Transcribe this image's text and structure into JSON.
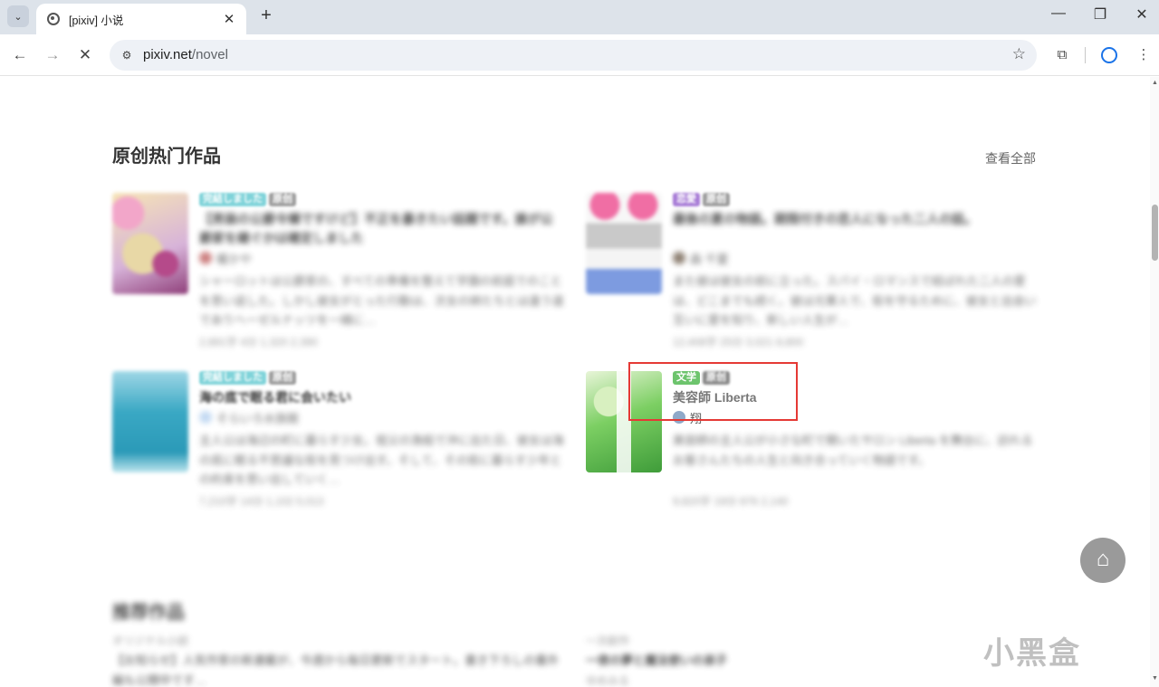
{
  "browser": {
    "tab_title": "[pixiv] 小说",
    "tab_close": "✕",
    "new_tab": "+",
    "url_host": "pixiv.net",
    "url_path": "/novel",
    "minimize": "—",
    "maximize": "❐",
    "close": "✕"
  },
  "section": {
    "title": "原创热门作品",
    "see_all": "查看全部"
  },
  "cards": [
    {
      "tags": [
        {
          "text": "完結しました",
          "color": "#7fd3d9"
        },
        {
          "text": "原创",
          "color": "#9e9e9e"
        }
      ],
      "title": "【男装の公爵令嬢ですけど】不正を暴きたい話題です。誰が公爵家を継ぐかは確定しました",
      "author": "暖かや",
      "desc": "シャーロットは公爵家の、すべての準備を整えて学園の前庭でのことを思い返した。しかし彼女がとった行動は、次女の姉たちとは違う道でありヘーゼルナッツを一緒に…",
      "meta": "2,891字 4分 1,320 2,390"
    },
    {
      "tags": [
        {
          "text": "恋愛",
          "color": "#a77bd6"
        },
        {
          "text": "原创",
          "color": "#9e9e9e"
        }
      ],
      "title": "最後の夏の物語。期限付きの恋人になった二人の話。",
      "author": "森 千夏",
      "desc": "また彼は彼女の前に立った。スパイ・ロマンスで結ばれた二人の愛は、どこまでも続く。彼は元軍人で、街を守るために、彼女と出会い互いに愛を知り、新しい人生が…",
      "meta": "12,408字 25分 3,021 8,800"
    },
    {
      "tags": [
        {
          "text": "完結しました",
          "color": "#7fd3d9"
        },
        {
          "text": "原创",
          "color": "#9e9e9e"
        }
      ],
      "title": "海の底で眠る君に会いたい",
      "author": "そらいろ水族館",
      "desc": "主人公は海辺の町に暮らす少女。祖父の漁船で沖に出た日、彼女は海の底に眠る不思議な街を見つけ出す。そして、その街に暮らす少年との約束を思い出していく…",
      "meta": "7,210字 14分 1,102 5,013"
    },
    {
      "tags": [
        {
          "text": "文学",
          "color": "#6dc46d"
        },
        {
          "text": "原创",
          "color": "#8a8a8a"
        }
      ],
      "title": "美容師 Liberta",
      "author": "翔",
      "desc": "美容師の主人公が小さな町で開いたサロン Liberta を舞台に、訪れるお客さんたちの人生と向き合っていく物語です。",
      "meta": "9,820字 19分 876 2,140"
    }
  ],
  "section2": {
    "title": "推荐作品",
    "left_label": "オリジナル小説",
    "left_text": "【お知らせ】人気作家の新連載が、今週から毎日更新でスタート。書き下ろしの番外編も公開中です…",
    "right_label": "一次創作",
    "right_text": "一夜の夢と魔法使いの弟子",
    "right_author": "ゆめみる"
  },
  "watermark": {
    "text": "小黑盒",
    "logo": "⌂"
  }
}
